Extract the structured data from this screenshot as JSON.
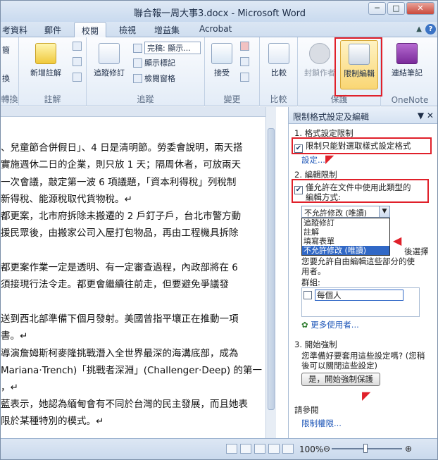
{
  "window": {
    "title": "聯合報一周大事3.docx - Microsoft Word",
    "buttons": {
      "minimize": "─",
      "maximize": "□",
      "close": "✕"
    }
  },
  "tabs": [
    "考資料",
    "郵件",
    "校閱",
    "檢視",
    "增益集",
    "Acrobat"
  ],
  "active_tab": "校閱",
  "ribbon": {
    "groups": {
      "proofing_partial": {
        "label": "轉換",
        "items": [
          "簡",
          "換"
        ]
      },
      "comments": {
        "label": "註解",
        "new_comment": "新增註解"
      },
      "tracking": {
        "label": "追蹤",
        "track_changes": "追蹤修訂",
        "display_dropdown": "完稿: 顯示...",
        "show_markup": "顯示標記",
        "reviewing_pane": "檢閱窗格"
      },
      "changes": {
        "label": "變更",
        "accept": "接受"
      },
      "compare": {
        "label": "比較",
        "compare_btn": "比較"
      },
      "protect": {
        "label": "保護",
        "block_authors": "封鎖作者",
        "restrict_editing": "限制編輯"
      },
      "onenote": {
        "label": "OneNote",
        "linked_notes": "連結筆記"
      }
    }
  },
  "document": {
    "paragraphs": [
      "、兒童節合併假日」、4 日是清明節。勞委會說明，兩天搭",
      "實施週休二日的企業，則只放 1 天；隔周休者，可放兩天",
      "一次會議，敲定第一波 6 項議題，「資本利得稅」列稅制",
      "新得稅、能源稅取代貨物稅。↵",
      "都更案，北市府拆除未搬遷的 2 戶釘子戶，台北市警方動",
      "援民眾後，由搬家公司入屋打包物品，再由工程機具拆除",
      "都更案作業一定是透明、有一定審查過程，內政部將在 6",
      "須接現行法令走。都更會繼續往前走，但要避免爭議發",
      "送到西北部準備下個月發射。美國曾指平壤正在推動一項",
      "書。↵",
      "導演詹姆斯柯麥隆挑戰潛入全世界最深的海溝底部，成為",
      "Mariana·Trench)「挑戰者深淵」(Challenger·Deep) 的第一",
      "，↵",
      "藍表示，她認為緬甸會有不同於台灣的民主發展，而且她表",
      "限於某種特別的模式。↵"
    ]
  },
  "pane": {
    "title": "限制格式設定及編輯",
    "section1_title": "1. 格式設定限制",
    "section1_checkbox": "限制只能對選取樣式設定格式",
    "section1_link": "設定...",
    "section2_title": "2. 編輯限制",
    "section2_checkbox_line1": "僅允許在文件中使用此類型的",
    "section2_checkbox_line2": "編輯方式:",
    "dropdown_value": "不允許修改 (唯讀)",
    "dropdown_options": [
      "追蹤修訂",
      "註解",
      "填寫表單",
      "不允許修改 (唯讀)"
    ],
    "selected_option": "不允許修改 (唯讀)",
    "exceptions_partial": "後選擇",
    "exceptions_text_line1": "您要允許自由編輯這些部分的使",
    "exceptions_text_line2": "用者。",
    "groups_label": "群組:",
    "everyone": "每個人",
    "more_users": "更多使用者...",
    "section3_title": "3. 開始強制",
    "section3_text_line1": "您準備好要套用這些設定嗎? (您稍",
    "section3_text_line2": "後可以關閉這些設定)",
    "enforce_button": "是，開始強制保護",
    "see_also": "請參閱",
    "permissions_link": "限制權限..."
  },
  "status": {
    "zoom": "100%",
    "zoom_minus": "⊖",
    "zoom_plus": "⊕"
  },
  "colors": {
    "highlight": "#e0202a",
    "selection": "#3168c6",
    "link": "#1f57b8"
  }
}
